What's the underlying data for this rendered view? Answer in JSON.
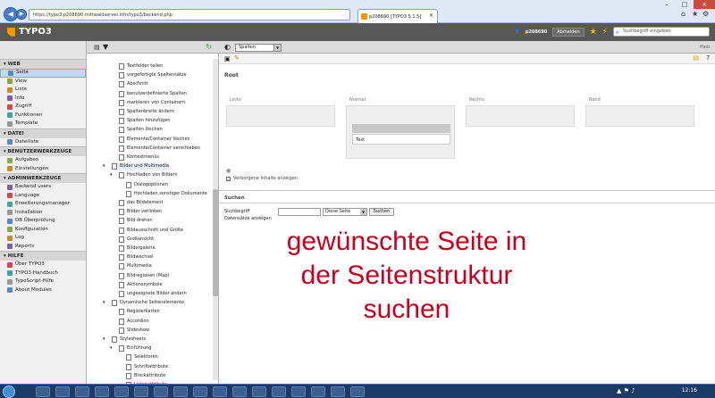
{
  "browser": {
    "url": "https://typo3.p208690.mittwaldserver.info/typo3/backend.php",
    "tab_title": "p208690 [TYPO3 5.1.5]"
  },
  "typo3_top": {
    "logo_text": "TYPO3",
    "user": "p208690",
    "logout": "Abmelden",
    "search_placeholder": "Suchbegriff eingeben"
  },
  "module_menu": {
    "groups": [
      {
        "label": "WEB",
        "items": [
          "Seite",
          "View",
          "Liste",
          "Info",
          "Zugriff",
          "Funktionen",
          "Template"
        ]
      },
      {
        "label": "DATEI",
        "items": [
          "Dateiliste"
        ]
      },
      {
        "label": "BENUTZERWERKZEUGE",
        "items": [
          "Aufgaben",
          "Einstellungen"
        ]
      },
      {
        "label": "ADMINWERKZEUGE",
        "items": [
          "Backend users",
          "Language",
          "Erweiterungsmanager",
          "Installation",
          "DB Überprüfung",
          "Konfiguration",
          "Log",
          "Reports"
        ]
      },
      {
        "label": "HILFE",
        "items": [
          "Über TYPO3",
          "TYPO3-Handbuch",
          "TypoScript-Hilfe",
          "About Modules"
        ]
      }
    ]
  },
  "tree": {
    "nodes": [
      "Textfelder teilen",
      "vorgefertigte Spaltensätze",
      "Abschnitt",
      "benutzerdefinierte Spalten",
      "markieren von Containern",
      "Spaltenbreite ändern",
      "Spalten hinzufügen",
      "Spalten löschen",
      "Elemente/Container löschen",
      "Elemente/Container verschieben",
      "Kontextmenüs",
      "Bilder und Multimedia",
      "Hochladen von Bildern",
      "Dialogoptionen",
      "Hochladen sonstiger Dokumente",
      "das Bildelement",
      "Bilder verlinken",
      "Bild drehen",
      "Bildausschnitt und Größe",
      "Großansicht",
      "Bildergalerie",
      "Bildwechsel",
      "Multimedia",
      "Bildregionen (Map)",
      "Aktionssymbole",
      "ungeeignete Bilder ändern",
      "Dynamische Seitenelemente",
      "Registerkarten",
      "Accordion",
      "Slideshow",
      "Stylesheets",
      "Einführung",
      "Selektoren",
      "Schriftattribute",
      "Blockattribute",
      "Listenattribute"
    ]
  },
  "content": {
    "view_select": "Spalten",
    "breadcrumb_right": "ffadi",
    "page_title": "Root",
    "columns": [
      "Links",
      "Normal",
      "Rechts",
      "Rand"
    ],
    "normal_element": "Text",
    "show_hidden_label": "Verborgene Inhalte anzeigen",
    "search_section_title": "Suchen",
    "search_label": "Suchbegriff",
    "search_scope": "Diese Seite",
    "search_button": "Suchen",
    "show_records_label": "Datensätze anzeigen",
    "overlay_text": [
      "gewünschte Seite in",
      "der Seitenstruktur",
      "suchen"
    ]
  },
  "taskbar": {
    "clock": "12:16"
  }
}
